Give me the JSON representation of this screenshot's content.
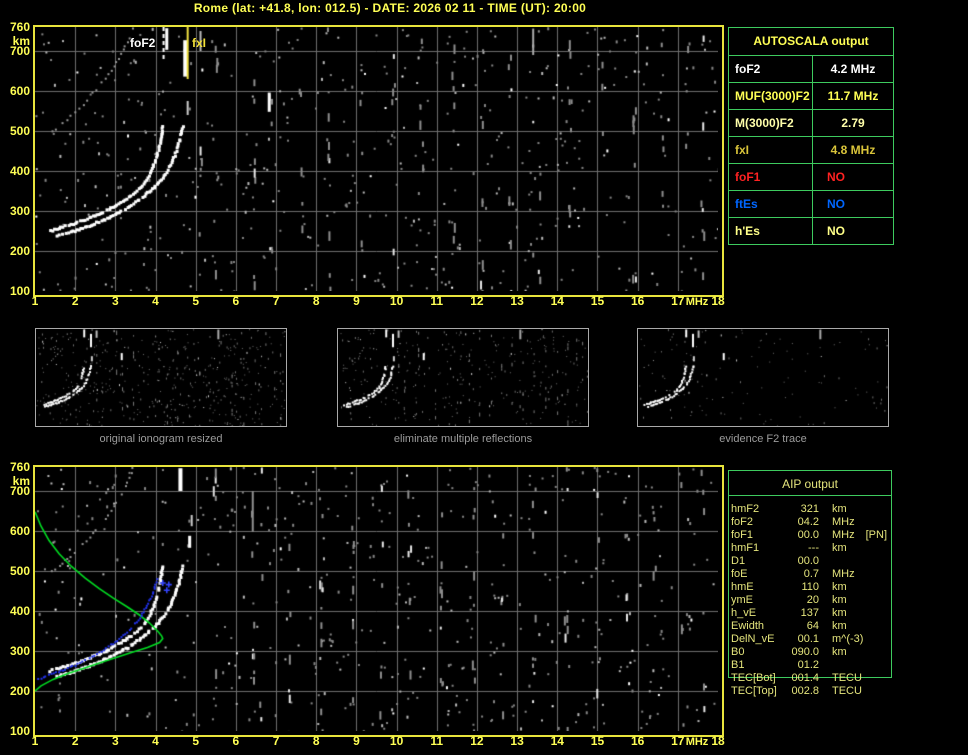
{
  "title": "Rome (lat: +41.8, lon: 012.5) - DATE: 2026 02 11 - TIME (UT): 20:00",
  "colors": {
    "background": "#000000",
    "axis_yellow": "#ffff55",
    "frame_yellow": "#e8e43c",
    "grid_gray": "#6e6e6e",
    "table_border_green": "#3dca5e",
    "profile_green": "#00dd22",
    "scaled_trace_blue": "#2233ee",
    "foF1_red": "#ff2222",
    "ftEs_blue": "#0066ff",
    "aip_text": "#e4e47c",
    "caption_gray": "#9c9c9c"
  },
  "top_plot": {
    "x_ticks": [
      1,
      2,
      3,
      4,
      5,
      6,
      7,
      8,
      9,
      10,
      11,
      12,
      13,
      14,
      15,
      16,
      17,
      18
    ],
    "x_unit": "MHz",
    "y_ticks": [
      760,
      700,
      600,
      500,
      400,
      300,
      200,
      100
    ],
    "y_unit": "km",
    "markers": {
      "foF2": {
        "label": "foF2",
        "freq_mhz": 4.2
      },
      "fxI": {
        "label": "fxI",
        "freq_mhz": 4.8
      }
    }
  },
  "bottom_plot": {
    "x_ticks": [
      1,
      2,
      3,
      4,
      5,
      6,
      7,
      8,
      9,
      10,
      11,
      12,
      13,
      14,
      15,
      16,
      17,
      18
    ],
    "x_unit": "MHz",
    "y_ticks": [
      760,
      700,
      600,
      500,
      400,
      300,
      200,
      100
    ],
    "y_unit": "km"
  },
  "autoscala_table": {
    "title": "AUTOSCALA output",
    "rows": [
      {
        "label": "foF2",
        "value": "4.2 MHz",
        "color": "#ffffff",
        "value_align": "center"
      },
      {
        "label": "MUF(3000)F2",
        "value": "11.7 MHz",
        "color": "#ffff55",
        "value_align": "center"
      },
      {
        "label": "M(3000)F2",
        "value": "2.79",
        "color": "#ffffaa",
        "value_align": "center"
      },
      {
        "label": "fxI",
        "value": "4.8 MHz",
        "color": "#d9c43a",
        "value_align": "center"
      },
      {
        "label": "foF1",
        "value": "NO",
        "color": "#ff2222",
        "value_align": "left"
      },
      {
        "label": "ftEs",
        "value": "NO",
        "color": "#0066ff",
        "value_align": "left"
      },
      {
        "label": "h'Es",
        "value": "NO",
        "color": "#ffff88",
        "value_align": "left"
      }
    ]
  },
  "thumbnails": [
    {
      "caption": "original ionogram resized",
      "noise_dots": 430,
      "columns": true
    },
    {
      "caption": "eliminate multiple reflections",
      "noise_dots": 260,
      "columns": true
    },
    {
      "caption": "evidence F2 trace",
      "noise_dots": 120,
      "columns": false
    }
  ],
  "aip_table": {
    "title": "AIP output",
    "rows": [
      {
        "label": "hmF2",
        "value": "321",
        "unit": "km",
        "extra": ""
      },
      {
        "label": "foF2",
        "value": "04.2",
        "unit": "MHz",
        "extra": ""
      },
      {
        "label": "foF1",
        "value": "00.0",
        "unit": "MHz",
        "extra": "[PN]"
      },
      {
        "label": "hmF1",
        "value": "---",
        "unit": "km",
        "extra": ""
      },
      {
        "label": "D1",
        "value": "00.0",
        "unit": "",
        "extra": ""
      },
      {
        "label": "foE",
        "value": "0.7",
        "unit": "MHz",
        "extra": ""
      },
      {
        "label": "hmE",
        "value": "110",
        "unit": "km",
        "extra": ""
      },
      {
        "label": "ymE",
        "value": "20",
        "unit": "km",
        "extra": ""
      },
      {
        "label": "h_vE",
        "value": "137",
        "unit": "km",
        "extra": ""
      },
      {
        "label": "Ewidth",
        "value": "64",
        "unit": "km",
        "extra": ""
      },
      {
        "label": "DelN_vE",
        "value": "00.1",
        "unit": "m^(-3)",
        "extra": ""
      },
      {
        "label": "B0",
        "value": "090.0",
        "unit": "km",
        "extra": ""
      },
      {
        "label": "B1",
        "value": "01.2",
        "unit": "",
        "extra": ""
      },
      {
        "label": "TEC[Bot]",
        "value": "001.4",
        "unit": "TECU",
        "extra": ""
      },
      {
        "label": "TEC[Top]",
        "value": "002.8",
        "unit": "TECU",
        "extra": ""
      }
    ]
  },
  "chart_data": [
    {
      "type": "scatter",
      "title": "autoscaled ionogram (top panel)",
      "xlabel": "MHz",
      "ylabel": "km",
      "xlim": [
        1,
        18
      ],
      "ylim": [
        100,
        760
      ],
      "grid": true,
      "noise_dots": 470,
      "noise_columns": [
        5.1,
        5.5,
        6.45,
        6.85,
        7.6,
        8.3,
        9.1,
        9.9,
        10.6,
        11.4,
        12.1,
        12.8,
        13.35,
        13.55,
        14.3,
        15.1,
        15.9,
        16.6,
        17.2,
        17.6
      ],
      "bars": [
        {
          "f": 4.28,
          "km": [
            703,
            757
          ],
          "w": 3,
          "color": "#ffffff"
        },
        {
          "f": 4.74,
          "km": [
            636,
            727
          ],
          "w": 4,
          "color": "#ffffff"
        },
        {
          "f": 4.8,
          "km": [
            540,
            575
          ],
          "w": 2,
          "color": "#cccccc"
        },
        {
          "f": 6.83,
          "km": [
            548,
            596
          ],
          "w": 3,
          "color": "#ffffff"
        },
        {
          "f": 5.12,
          "km": [
            700,
            750
          ],
          "w": 2,
          "color": "#bbbbbb"
        },
        {
          "f": 13.4,
          "km": [
            690,
            756
          ],
          "w": 2,
          "color": "#aaaaaa"
        }
      ],
      "series": [
        {
          "name": "O-mode echo trace",
          "style": "dots",
          "color": "#ffffff",
          "size": 3,
          "step": 2.3,
          "points": [
            [
              1.38,
              250
            ],
            [
              1.65,
              258
            ],
            [
              1.95,
              267
            ],
            [
              2.25,
              278
            ],
            [
              2.55,
              290
            ],
            [
              2.85,
              304
            ],
            [
              3.1,
              318
            ],
            [
              3.35,
              334
            ],
            [
              3.55,
              350
            ],
            [
              3.72,
              368
            ],
            [
              3.85,
              388
            ],
            [
              3.95,
              410
            ],
            [
              4.03,
              434
            ],
            [
              4.09,
              458
            ],
            [
              4.13,
              480
            ],
            [
              4.16,
              500
            ],
            [
              4.18,
              510
            ]
          ]
        },
        {
          "name": "X-mode echo trace",
          "style": "dots",
          "color": "#ffffff",
          "size": 3,
          "step": 2.3,
          "points": [
            [
              1.55,
              237
            ],
            [
              1.85,
              245
            ],
            [
              2.15,
              255
            ],
            [
              2.45,
              266
            ],
            [
              2.75,
              279
            ],
            [
              3.05,
              294
            ],
            [
              3.35,
              311
            ],
            [
              3.6,
              328
            ],
            [
              3.85,
              348
            ],
            [
              4.08,
              370
            ],
            [
              4.25,
              392
            ],
            [
              4.38,
              415
            ],
            [
              4.48,
              438
            ],
            [
              4.56,
              462
            ],
            [
              4.62,
              485
            ],
            [
              4.66,
              505
            ],
            [
              4.68,
              512
            ]
          ]
        },
        {
          "name": "second-hop multiple",
          "style": "dots",
          "color": "#989898",
          "size": 2,
          "step": 5,
          "density": 0.7,
          "points": [
            [
              1.42,
              498
            ],
            [
              1.7,
              520
            ],
            [
              2.0,
              545
            ],
            [
              2.3,
              576
            ],
            [
              2.6,
              612
            ],
            [
              2.9,
              650
            ],
            [
              3.15,
              692
            ],
            [
              3.35,
              732
            ],
            [
              3.44,
              757
            ]
          ]
        }
      ],
      "annotations": [
        {
          "label": "foF2",
          "x": 4.2,
          "color": "#ffffff",
          "dash": true,
          "len": 34
        },
        {
          "label": "fxI",
          "x": 4.8,
          "color": "#f0e040",
          "dash": false,
          "len": 52
        }
      ]
    },
    {
      "type": "scatter",
      "title": "ionogram with restored electron density profile (bottom panel)",
      "xlabel": "MHz",
      "ylabel": "km",
      "xlim": [
        1,
        18
      ],
      "ylim": [
        100,
        760
      ],
      "grid": true,
      "noise_dots": 470,
      "noise_columns": [
        5.45,
        6.4,
        6.6,
        7.3,
        8.1,
        8.9,
        9.6,
        10.3,
        11.1,
        11.9,
        12.6,
        13.4,
        14.2,
        15.0,
        15.7,
        16.4,
        17.1,
        17.6
      ],
      "bars": [
        {
          "f": 4.62,
          "km": [
            700,
            757
          ],
          "w": 4,
          "color": "#ffffff"
        },
        {
          "f": 4.85,
          "km": [
            558,
            588
          ],
          "w": 3,
          "color": "#ffffff"
        },
        {
          "f": 4.9,
          "km": [
            612,
            640
          ],
          "w": 2,
          "color": "#cccccc"
        },
        {
          "f": 5.45,
          "km": [
            686,
            712
          ],
          "w": 2,
          "color": "#dddddd"
        },
        {
          "f": 6.42,
          "km": [
            598,
            700
          ],
          "w": 2,
          "color": "#909090"
        }
      ],
      "series": [
        {
          "name": "O-mode echo trace",
          "style": "dots",
          "color": "#ffffff",
          "size": 3,
          "step": 2.3,
          "points": [
            [
              1.38,
              250
            ],
            [
              1.65,
              258
            ],
            [
              1.95,
              267
            ],
            [
              2.25,
              278
            ],
            [
              2.55,
              290
            ],
            [
              2.85,
              304
            ],
            [
              3.1,
              318
            ],
            [
              3.35,
              334
            ],
            [
              3.55,
              350
            ],
            [
              3.72,
              368
            ],
            [
              3.85,
              388
            ],
            [
              3.95,
              410
            ],
            [
              4.03,
              434
            ],
            [
              4.09,
              458
            ],
            [
              4.13,
              480
            ],
            [
              4.16,
              500
            ],
            [
              4.18,
              510
            ]
          ]
        },
        {
          "name": "X-mode echo trace",
          "style": "dots",
          "color": "#ffffff",
          "size": 3,
          "step": 2.3,
          "points": [
            [
              1.55,
              237
            ],
            [
              1.85,
              245
            ],
            [
              2.15,
              255
            ],
            [
              2.45,
              266
            ],
            [
              2.75,
              279
            ],
            [
              3.05,
              294
            ],
            [
              3.35,
              311
            ],
            [
              3.6,
              328
            ],
            [
              3.85,
              348
            ],
            [
              4.08,
              370
            ],
            [
              4.25,
              392
            ],
            [
              4.38,
              415
            ],
            [
              4.48,
              438
            ],
            [
              4.56,
              462
            ],
            [
              4.62,
              485
            ],
            [
              4.66,
              505
            ],
            [
              4.68,
              512
            ]
          ]
        },
        {
          "name": "second-hop multiple",
          "style": "dots",
          "color": "#989898",
          "size": 2,
          "step": 5,
          "density": 0.7,
          "points": [
            [
              1.42,
              498
            ],
            [
              1.7,
              520
            ],
            [
              2.0,
              545
            ],
            [
              2.3,
              576
            ],
            [
              2.6,
              612
            ],
            [
              2.9,
              650
            ],
            [
              3.15,
              692
            ],
            [
              3.35,
              732
            ],
            [
              3.44,
              757
            ]
          ]
        },
        {
          "name": "restored N(h) profile",
          "style": "line",
          "color": "#00dd22",
          "points": [
            [
              1.0,
              648
            ],
            [
              1.15,
              612
            ],
            [
              1.35,
              576
            ],
            [
              1.6,
              543
            ],
            [
              1.9,
              512
            ],
            [
              2.25,
              482
            ],
            [
              2.6,
              456
            ],
            [
              2.95,
              432
            ],
            [
              3.3,
              410
            ],
            [
              3.6,
              390
            ],
            [
              3.85,
              370
            ],
            [
              4.05,
              350
            ],
            [
              4.15,
              338
            ],
            [
              4.18,
              331
            ],
            [
              4.1,
              321
            ],
            [
              3.8,
              309
            ],
            [
              3.4,
              296
            ],
            [
              3.0,
              283
            ],
            [
              2.6,
              270
            ],
            [
              2.2,
              256
            ],
            [
              1.8,
              243
            ],
            [
              1.45,
              229
            ],
            [
              1.15,
              213
            ],
            [
              1.0,
              200
            ]
          ]
        },
        {
          "name": "scaled O-trace fit",
          "style": "dots",
          "color": "#2233ee",
          "size": 2,
          "step": 2.6,
          "density": 0.92,
          "points": [
            [
              1.08,
              230
            ],
            [
              1.4,
              241
            ],
            [
              1.7,
              252
            ],
            [
              2.0,
              264
            ],
            [
              2.3,
              279
            ],
            [
              2.6,
              296
            ],
            [
              2.9,
              315
            ],
            [
              3.2,
              338
            ],
            [
              3.45,
              362
            ],
            [
              3.65,
              388
            ],
            [
              3.8,
              414
            ],
            [
              3.92,
              442
            ],
            [
              4.0,
              466
            ],
            [
              4.05,
              480
            ]
          ]
        }
      ],
      "plus_marks": [
        [
          4.18,
          470
        ],
        [
          4.28,
          452
        ],
        [
          4.33,
          466
        ]
      ]
    }
  ]
}
